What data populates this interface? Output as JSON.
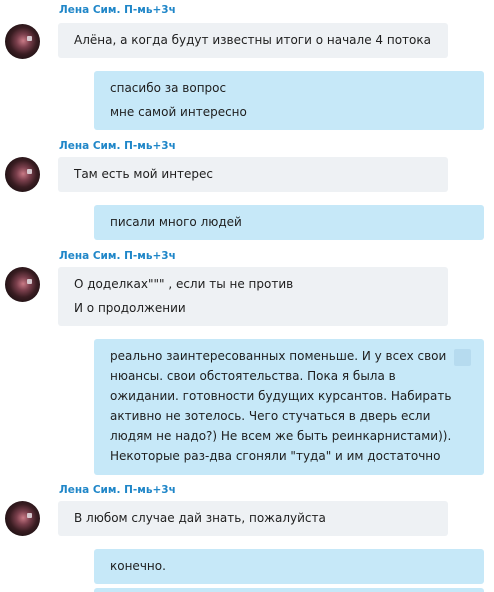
{
  "messages": [
    {
      "sender": "Лена Сим. П-мь+3ч",
      "lines": [
        "Алёна,  а когда будут известны итоги о начале 4 потока"
      ]
    },
    {
      "lines": [
        "спасибо за вопрос",
        "мне самой интересно"
      ]
    },
    {
      "sender": "Лена Сим. П-мь+3ч",
      "lines": [
        "Там есть мой интерес"
      ]
    },
    {
      "lines": [
        "писали много людей"
      ]
    },
    {
      "sender": "Лена Сим. П-мь+3ч",
      "lines": [
        "О доделках\"\"\" , если ты не против",
        "И о продолжении"
      ]
    },
    {
      "lines": [
        "реально заинтересованных поменьше. И у всех свои",
        "нюансы. свои обстоятельства. Пока я была в",
        "ожидании.  готовности будущих курсантов. Набирать",
        "активно не зотелось. Чего стучаться в дверь если",
        "людям не надо?) Не всем же быть реинкарнистами)).",
        "Некоторые раз-два сгоняли \"туда\" и им достаточно"
      ]
    },
    {
      "sender": "Лена Сим. П-мь+3ч",
      "lines": [
        "В любом случае дай знать, пожалуйста"
      ]
    },
    {
      "lines": [
        "конечно."
      ]
    }
  ]
}
